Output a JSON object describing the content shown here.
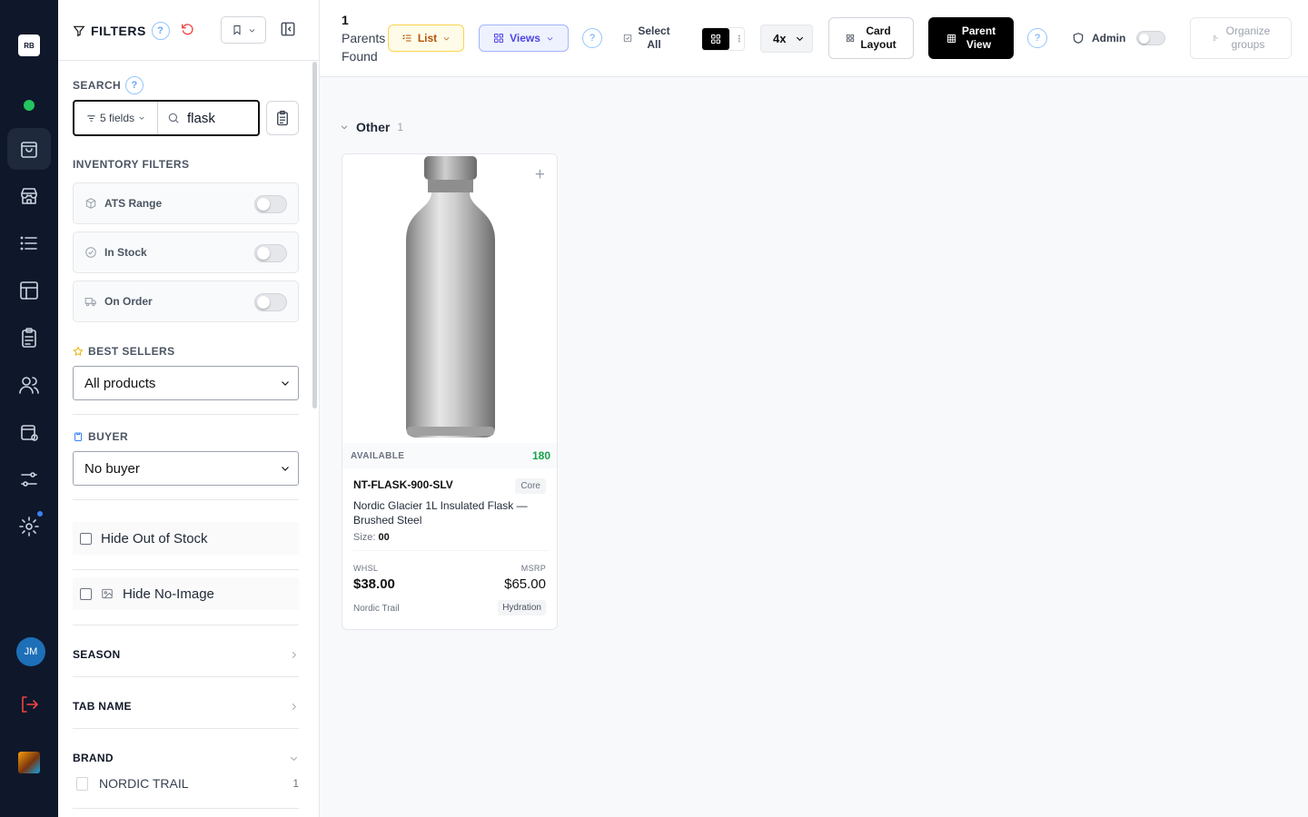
{
  "rail": {
    "logo": "RB",
    "avatar_initials": "JM"
  },
  "filters": {
    "title": "FILTERS",
    "help": "?",
    "search_label": "SEARCH",
    "search_fields": "5 fields",
    "search_query": "flask",
    "inventory_label": "INVENTORY FILTERS",
    "inventory": [
      {
        "label": "ATS Range",
        "icon": "box-icon"
      },
      {
        "label": "In Stock",
        "icon": "check-circle-icon"
      },
      {
        "label": "On Order",
        "icon": "truck-icon"
      }
    ],
    "best_sellers_label": "BEST SELLERS",
    "best_sellers_value": "All products",
    "buyer_label": "BUYER",
    "buyer_value": "No buyer",
    "hide_out_of_stock": "Hide Out of Stock",
    "hide_no_image": "Hide No-Image",
    "season_label": "SEASON",
    "tab_name_label": "TAB NAME",
    "brand_label": "BRAND",
    "brand_items": [
      {
        "label": "NORDIC TRAIL",
        "count": "1"
      }
    ]
  },
  "toolbar": {
    "found_count": "1",
    "found_line1": "Parents",
    "found_line2": "Found",
    "list_label": "List",
    "views_label": "Views",
    "select_all_1": "Select",
    "select_all_2": "All",
    "columns_value": "4x",
    "card_layout_1": "Card",
    "card_layout_2": "Layout",
    "parent_view_1": "Parent",
    "parent_view_2": "View",
    "admin_label": "Admin",
    "organize_1": "Organize",
    "organize_2": "groups",
    "help": "?"
  },
  "group": {
    "name": "Other",
    "count": "1"
  },
  "product": {
    "available_label": "AVAILABLE",
    "available_value": "180",
    "sku": "NT-FLASK-900-SLV",
    "tag": "Core",
    "name": "Nordic Glacier 1L Insulated Flask — Brushed Steel",
    "size_label": "Size:",
    "size_value": "00",
    "whsl_label": "WHSL",
    "whsl_value": "$38.00",
    "msrp_label": "MSRP",
    "msrp_value": "$65.00",
    "vendor": "Nordic Trail",
    "category": "Hydration"
  },
  "colors": {
    "rail_bg": "#0f172a",
    "accent_green": "#16a34a",
    "list_accent": "#b45309",
    "views_accent": "#4f46e5",
    "reset_red": "#ef4444"
  }
}
